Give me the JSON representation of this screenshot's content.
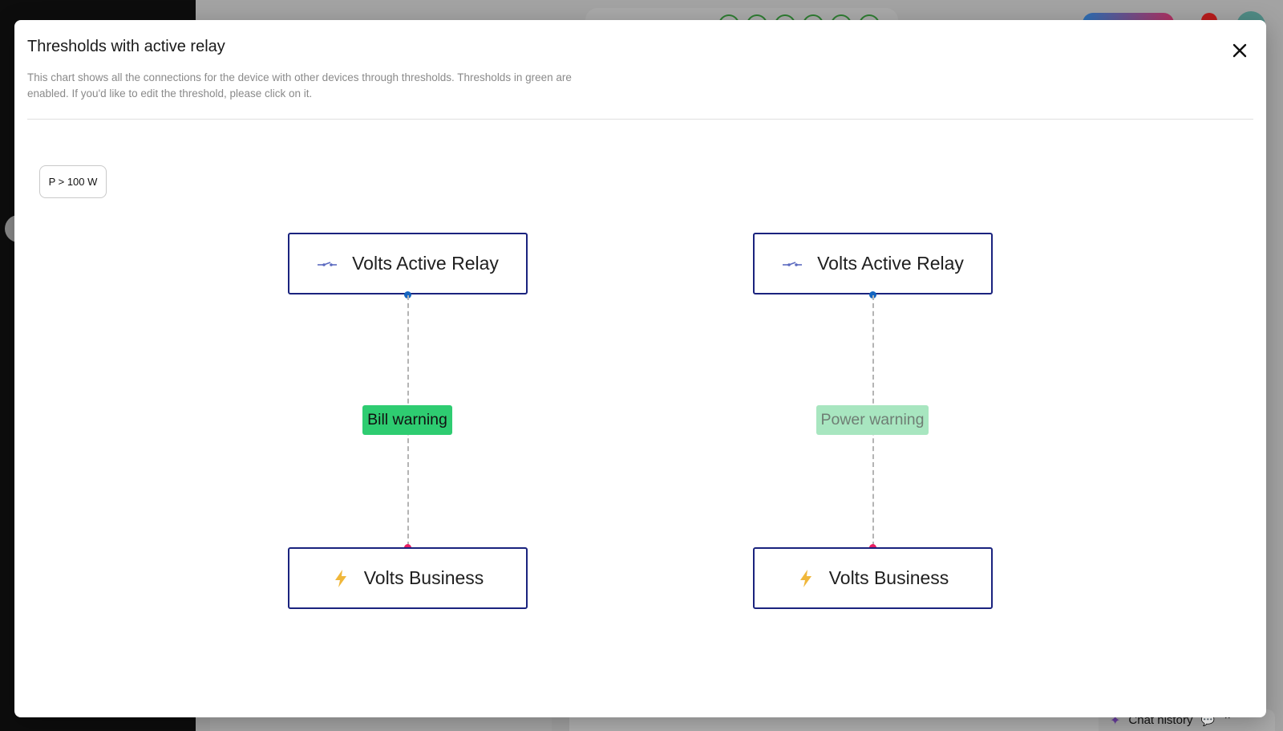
{
  "background": {
    "chat_label": "Chat history",
    "status_colors": [
      "#2e7d32"
    ]
  },
  "modal": {
    "title": "Thresholds with active relay",
    "description": "This chart shows all the connections for the device with other devices through thresholds. Thresholds in green are enabled. If you'd like to edit the threshold, please click on it.",
    "close_icon": "close-icon"
  },
  "threshold_chip": {
    "label": "P > 100 W"
  },
  "diagram": {
    "connections": [
      {
        "source": {
          "label": "Volts Active Relay",
          "icon": "relay-icon"
        },
        "threshold": {
          "label": "Bill warning",
          "enabled": true,
          "color": "#2ecc71"
        },
        "target": {
          "label": "Volts Business",
          "icon": "lightning-icon"
        }
      },
      {
        "source": {
          "label": "Volts Active Relay",
          "icon": "relay-icon"
        },
        "threshold": {
          "label": "Power warning",
          "enabled": false,
          "color": "#a8e6c0"
        },
        "target": {
          "label": "Volts Business",
          "icon": "lightning-icon"
        }
      }
    ],
    "colors": {
      "node_border": "#1a237e",
      "source_handle": "#1565c0",
      "target_handle": "#e91e63",
      "lightning": "#f0b73a",
      "relay": "#5c6bc0"
    }
  }
}
